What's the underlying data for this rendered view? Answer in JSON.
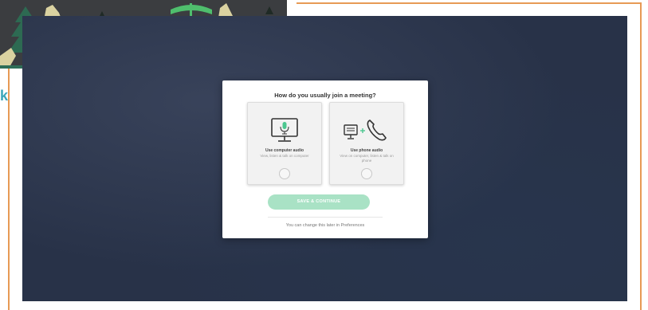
{
  "illustration": {
    "name": "wolves-and-trees-illustration",
    "colors": {
      "background": "#3b3d40",
      "wolf": "#dad2a0",
      "tree": "#4fbe6d",
      "dark-tree": "#2d6a52"
    }
  },
  "frame": {
    "accent": "#e79a55",
    "side_glyph": "k"
  },
  "dialog": {
    "title": "How do you usually join a meeting?",
    "options": [
      {
        "icon": "monitor-microphone-icon",
        "title": "Use computer audio",
        "description": "View, listen & talk on computer"
      },
      {
        "icon": "computer-plus-phone-icon",
        "title": "Use phone audio",
        "description": "View on computer, listen & talk on phone"
      }
    ],
    "save_label": "SAVE & CONTINUE",
    "footer_note": "You can change this later in Preferences",
    "colors": {
      "accent": "#4cc790",
      "button_disabled": "#a9e2c5"
    }
  }
}
